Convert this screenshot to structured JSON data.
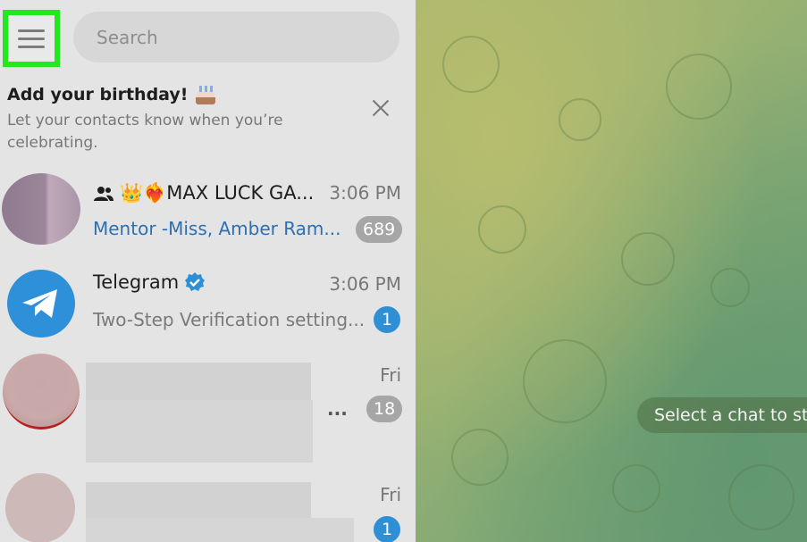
{
  "sidebar": {
    "search": {
      "placeholder": "Search"
    },
    "banner": {
      "title": "Add your birthday!",
      "subtitle": "Let your contacts know when you’re celebrating."
    },
    "chats": [
      {
        "name": "👑❤️‍🔥MAX LUCK GA...",
        "time": "3:06 PM",
        "preview": "Mentor -Miss, Amber Ram...",
        "unread": "689",
        "type": "group"
      },
      {
        "name": "Telegram",
        "time": "3:06 PM",
        "preview": "Two-Step Verification setting...",
        "unread": "1",
        "verified": true
      },
      {
        "name": "",
        "time": "Fri",
        "preview": "...",
        "unread": "18"
      },
      {
        "name": "",
        "time": "Fri",
        "preview": "",
        "unread": "1"
      }
    ]
  },
  "main": {
    "empty_state": "Select a chat to st"
  },
  "colors": {
    "accent": "#2f8fd4",
    "highlight": "#22e81f",
    "muted_badge": "#a6a6a6"
  }
}
